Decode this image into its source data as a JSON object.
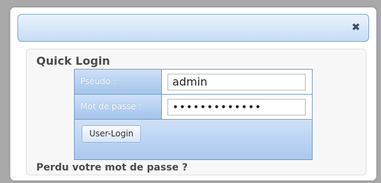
{
  "dialog": {
    "close_icon": "close-icon",
    "close_symbol": "✖"
  },
  "quick_login": {
    "heading": "Quick Login",
    "pseudo_label": "Pseudo :",
    "pseudo_value": "admin",
    "password_label": "Mot de passe :",
    "password_value": "•••••••••••••",
    "login_button": "User-Login",
    "forgot_link": "Perdu votre mot de passe ?"
  }
}
